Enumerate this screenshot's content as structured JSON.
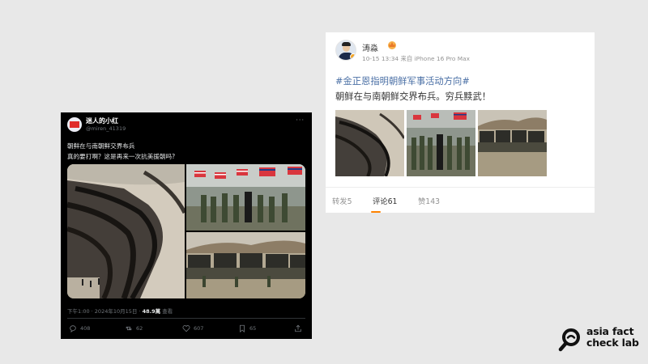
{
  "tweet": {
    "display_name": "迷人的小红",
    "handle": "@miren_41319",
    "more": "···",
    "text_line1": "朝鲜在与南朝鲜交界布兵",
    "text_line2": "真的要打啊？这是再来一次抗美援朝吗?",
    "timestamp": "下午1:00 · 2024年10月15日 · ",
    "views_value": "48.9萬",
    "views_label": " 查看",
    "actions": {
      "reply_count": "408",
      "retweet_count": "62",
      "like_count": "607",
      "bookmark_count": "65"
    }
  },
  "weibo": {
    "username": "涛淼",
    "meta": "10-15 13:34 来自 iPhone 16 Pro Max",
    "hashtag": "#金正恩指明朝鲜军事活动方向#",
    "body": "朝鲜在与南朝鲜交界布兵。穷兵黩武！",
    "tabs": {
      "repost": "转发5",
      "comment": "评论61",
      "like": "赞143"
    },
    "accent_color": "#ff8200",
    "link_color": "#4a6fa5"
  },
  "logo": {
    "line1": "asia fact",
    "line2": "check lab"
  }
}
